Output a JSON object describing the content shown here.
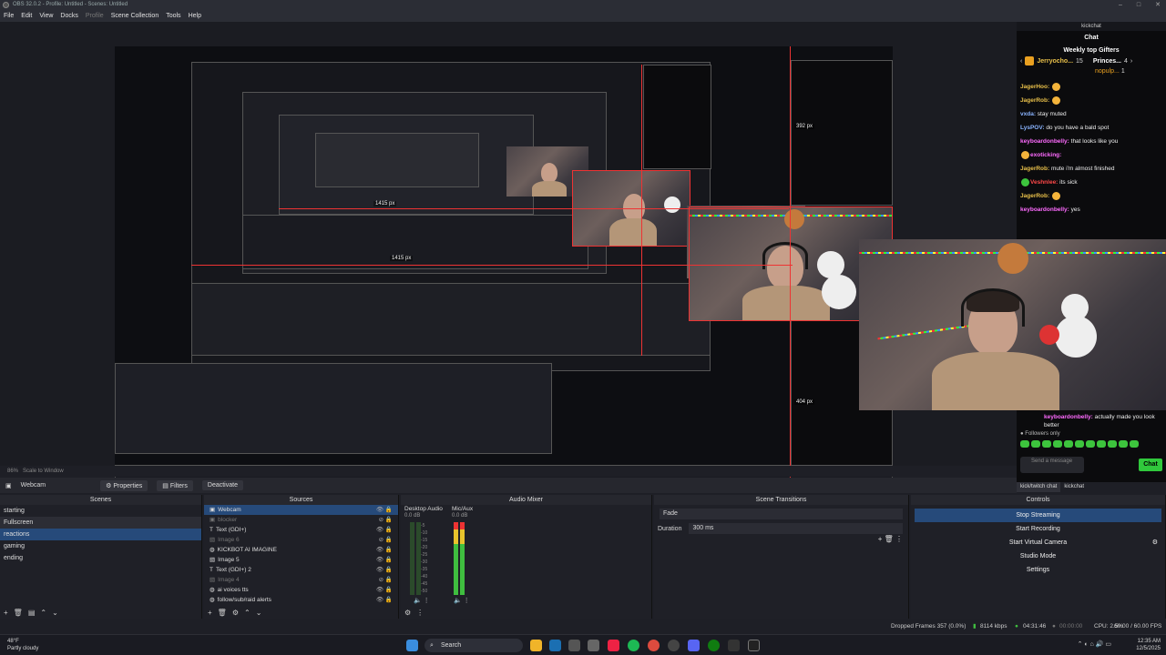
{
  "window": {
    "title": "OBS 32.0.2 - Profile: Untitled - Scenes: Untitled"
  },
  "menu": [
    "File",
    "Edit",
    "View",
    "Docks",
    "Profile",
    "Scene Collection",
    "Tools",
    "Help"
  ],
  "preview": {
    "px_label_1": "1415 px",
    "px_label_2": "1415 px",
    "px_label_3": "392 px",
    "px_label_4": "404 px"
  },
  "chat": {
    "dock_title": "kickchat",
    "title": "Chat",
    "gifters_title": "Weekly top Gifters",
    "gifter1_name": "Jerryocho...",
    "gifter1_count": "15",
    "gifter2_name": "Princes...",
    "gifter2_count": "4",
    "gifter3_name": "nopulp...",
    "gifter3_count": "1",
    "messages": [
      {
        "user": "JagerHoo:",
        "text": ""
      },
      {
        "user": "JagerRob:",
        "text": ""
      },
      {
        "user": "vxda:",
        "text": "stay muted"
      },
      {
        "user": "LysPOV:",
        "text": "do you have a bald spot"
      },
      {
        "user": "keyboardonbelly:",
        "text": "that looks like you"
      },
      {
        "user": "exoticking:",
        "text": ""
      },
      {
        "user": "JagerRob:",
        "text": "mute i'm almost finished"
      },
      {
        "user": "Veshnlee:",
        "text": "its sick"
      },
      {
        "user": "JagerRob:",
        "text": ""
      },
      {
        "user": "keyboardonbelly:",
        "text": "yes"
      }
    ],
    "tail_message_user": "keyboardonbelly:",
    "tail_message_text": "actually made you look better",
    "followers_only": "Followers only",
    "input_placeholder": "Send a message",
    "send_button": "Chat",
    "tabs": [
      "kick/twitch chat",
      "kickchat"
    ]
  },
  "status_row": {
    "zoom": "86%",
    "scale": "Scale to Window"
  },
  "source_toolbar": {
    "selected_source": "Webcam",
    "properties": "Properties",
    "filters": "Filters",
    "deactivate": "Deactivate"
  },
  "scenes": {
    "title": "Scenes",
    "items": [
      "starting",
      "Fullscreen",
      "reactions",
      "gaming",
      "ending"
    ],
    "selected_index": 2
  },
  "sources": {
    "title": "Sources",
    "items": [
      {
        "name": "Webcam",
        "dim": false
      },
      {
        "name": "blocker",
        "dim": true
      },
      {
        "name": "Text (GDI+)",
        "dim": false
      },
      {
        "name": "Image 6",
        "dim": true
      },
      {
        "name": "KICKBOT AI IMAGINE",
        "dim": false
      },
      {
        "name": "Image 5",
        "dim": false
      },
      {
        "name": "Text (GDI+) 2",
        "dim": false
      },
      {
        "name": "Image 4",
        "dim": true
      },
      {
        "name": "ai voices tts",
        "dim": false
      },
      {
        "name": "follow/sub/raid alerts",
        "dim": false
      }
    ]
  },
  "audio_mixer": {
    "title": "Audio Mixer",
    "desktop_label": "Desktop Audio",
    "desktop_db": "0.0 dB",
    "mic_label": "Mic/Aux",
    "mic_db": "0.0 dB",
    "desktop_level": 0.0,
    "mic_level": 0.55
  },
  "transitions": {
    "title": "Scene Transitions",
    "type": "Fade",
    "duration_label": "Duration",
    "duration_value": "300 ms"
  },
  "controls": {
    "title": "Controls",
    "stop_streaming": "Stop Streaming",
    "start_recording": "Start Recording",
    "start_virtual_camera": "Start Virtual Camera",
    "studio_mode": "Studio Mode",
    "settings": "Settings"
  },
  "statusbar": {
    "dropped": "Dropped Frames 357 (0.0%)",
    "bitrate": "8114 kbps",
    "stream_time": "04:31:46",
    "record_time": "00:00:00",
    "cpu": "CPU: 2.5%",
    "fps": "60.00 / 60.00 FPS"
  },
  "taskbar": {
    "temp": "48°F",
    "weather": "Partly cloudy",
    "search": "Search",
    "time": "12:35 AM",
    "date": "12/5/2025"
  },
  "colors": {
    "accent": "#264a7a",
    "live_green": "#30c83c",
    "guide_red": "#ee3333"
  }
}
